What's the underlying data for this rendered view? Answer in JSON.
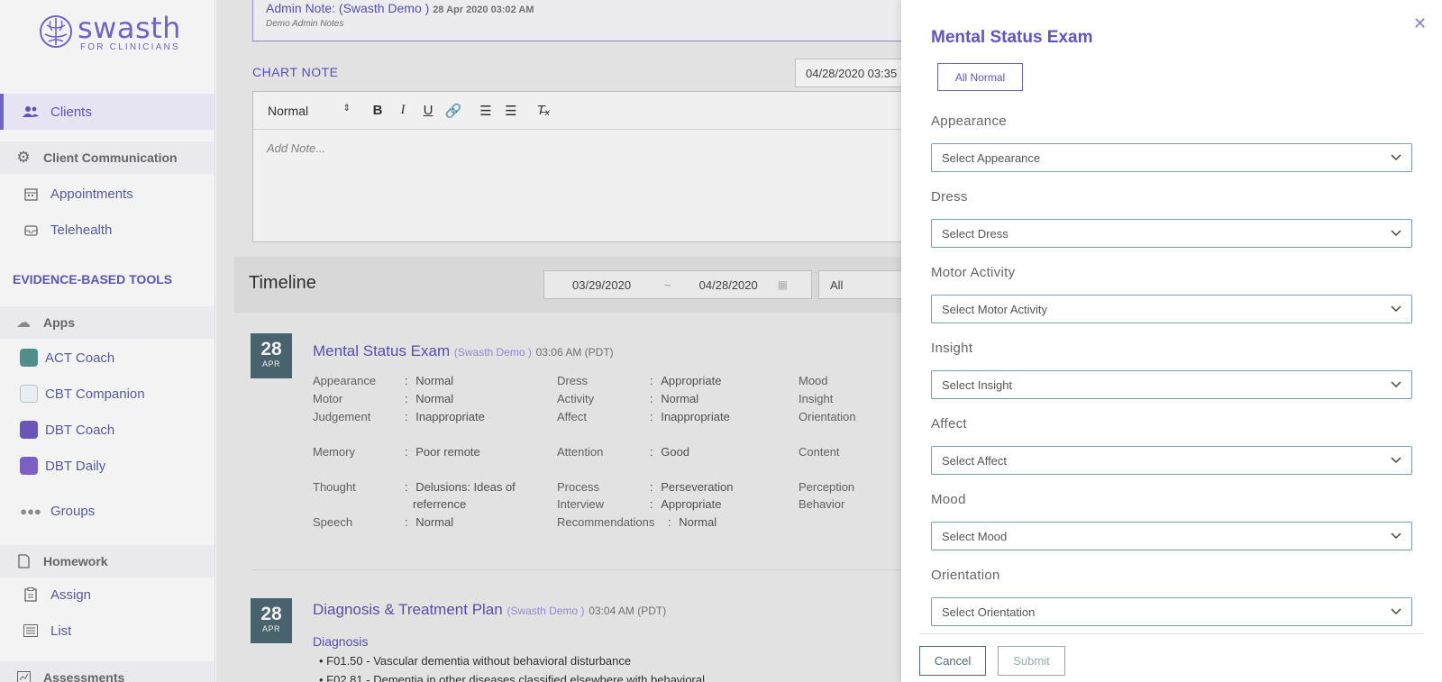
{
  "brand": {
    "name": "swasth",
    "tagline": "FOR CLINICIANS"
  },
  "sidebar": {
    "clients": "Clients",
    "client_communication": "Client Communication",
    "appointments": "Appointments",
    "telehealth": "Telehealth",
    "tools_heading": "EVIDENCE-BASED TOOLS",
    "apps": "Apps",
    "act_coach": "ACT Coach",
    "cbt_companion": "CBT Companion",
    "dbt_coach": "DBT Coach",
    "dbt_daily": "DBT Daily",
    "groups": "Groups",
    "homework": "Homework",
    "assign": "Assign",
    "list": "List",
    "assessments": "Assessments"
  },
  "admin_note": {
    "title": "Admin Note:  (Swasth Demo )",
    "timestamp": "28 Apr 2020 03:02 AM",
    "body": "Demo Admin Notes"
  },
  "chart_note": {
    "label": "CHART NOTE",
    "date_value": "04/28/2020 03:35",
    "format_select": "Normal",
    "placeholder": "Add Note..."
  },
  "timeline": {
    "title": "Timeline",
    "range_start": "03/29/2020",
    "range_sep": "~",
    "range_end": "04/28/2020",
    "filter": "All"
  },
  "entries": [
    {
      "day": "28",
      "month": "APR",
      "title": "Mental Status Exam",
      "by": "(Swasth Demo )",
      "time": "03:06 AM (PDT)",
      "col1": [
        [
          "Appearance",
          "Normal"
        ],
        [
          "Motor",
          "Normal"
        ],
        [
          "Judgement",
          "Inappropriate"
        ],
        [
          "Memory",
          "Poor remote"
        ],
        [
          "Thought",
          "Delusions: Ideas of"
        ],
        [
          "",
          "referrence"
        ],
        [
          "Speech",
          "Normal"
        ]
      ],
      "col2": [
        [
          "Dress",
          "Appropriate"
        ],
        [
          "Activity",
          "Normal"
        ],
        [
          "Affect",
          "Inappropriate"
        ],
        [
          "Attention",
          "Good"
        ],
        [
          "Process",
          "Perseveration"
        ],
        [
          "Interview",
          "Appropriate"
        ],
        [
          "Recommendations",
          "Normal"
        ]
      ],
      "col3": [
        "Mood",
        "Insight",
        "Orientation",
        "Content",
        "Perception",
        "Behavior"
      ]
    },
    {
      "day": "28",
      "month": "APR",
      "title": "Diagnosis & Treatment Plan",
      "by": "(Swasth Demo )",
      "time": "03:04 AM (PDT)",
      "diagnosis_heading": "Diagnosis",
      "diagnoses": [
        "F01.50 - Vascular dementia without behavioral disturbance",
        "F02.81 - Dementia in other diseases classified elsewhere with behavioral"
      ]
    }
  ],
  "drawer": {
    "title": "Mental Status Exam",
    "all_normal": "All Normal",
    "fields": [
      {
        "label": "Appearance",
        "placeholder": "Select Appearance"
      },
      {
        "label": "Dress",
        "placeholder": "Select Dress"
      },
      {
        "label": "Motor Activity",
        "placeholder": "Select Motor Activity"
      },
      {
        "label": "Insight",
        "placeholder": "Select Insight"
      },
      {
        "label": "Affect",
        "placeholder": "Select Affect"
      },
      {
        "label": "Mood",
        "placeholder": "Select Mood"
      },
      {
        "label": "Orientation",
        "placeholder": "Select Orientation"
      }
    ],
    "cancel": "Cancel",
    "submit": "Submit"
  },
  "colors": {
    "accent": "#6f63c6",
    "date_badge": "#4d6a75",
    "select_border": "#7aa0aa"
  }
}
